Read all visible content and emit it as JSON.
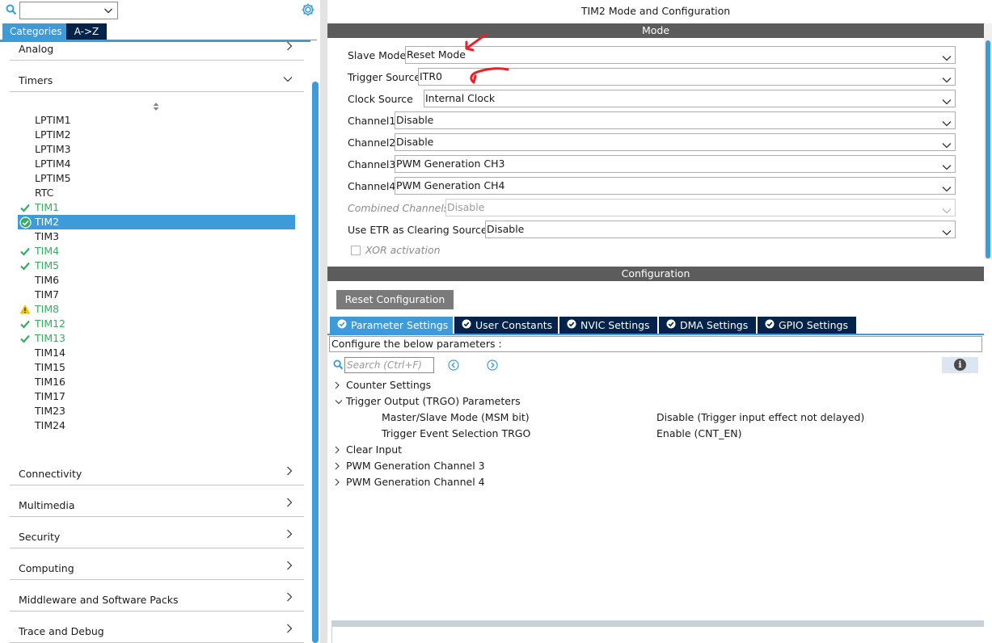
{
  "left_panel": {
    "search_value": "",
    "icons": {
      "search": "search-icon",
      "settings": "gear-icon"
    },
    "view_tabs": {
      "categories": "Categories",
      "a_to_z": "A->Z"
    },
    "categories_top": [
      {
        "label": "Analog",
        "expanded": false
      },
      {
        "label": "Timers",
        "expanded": true
      }
    ],
    "timers": [
      {
        "name": "LPTIM1",
        "status": "none"
      },
      {
        "name": "LPTIM2",
        "status": "none"
      },
      {
        "name": "LPTIM3",
        "status": "none"
      },
      {
        "name": "LPTIM4",
        "status": "none"
      },
      {
        "name": "LPTIM5",
        "status": "none"
      },
      {
        "name": "RTC",
        "status": "none"
      },
      {
        "name": "TIM1",
        "status": "ok"
      },
      {
        "name": "TIM2",
        "status": "ok",
        "selected": true
      },
      {
        "name": "TIM3",
        "status": "none"
      },
      {
        "name": "TIM4",
        "status": "ok"
      },
      {
        "name": "TIM5",
        "status": "ok"
      },
      {
        "name": "TIM6",
        "status": "none"
      },
      {
        "name": "TIM7",
        "status": "none"
      },
      {
        "name": "TIM8",
        "status": "warn"
      },
      {
        "name": "TIM12",
        "status": "ok"
      },
      {
        "name": "TIM13",
        "status": "ok"
      },
      {
        "name": "TIM14",
        "status": "none"
      },
      {
        "name": "TIM15",
        "status": "none"
      },
      {
        "name": "TIM16",
        "status": "none"
      },
      {
        "name": "TIM17",
        "status": "none"
      },
      {
        "name": "TIM23",
        "status": "none"
      },
      {
        "name": "TIM24",
        "status": "none"
      }
    ],
    "categories_bottom": [
      {
        "label": "Connectivity"
      },
      {
        "label": "Multimedia"
      },
      {
        "label": "Security"
      },
      {
        "label": "Computing"
      },
      {
        "label": "Middleware and Software Packs"
      },
      {
        "label": "Trace and Debug"
      }
    ]
  },
  "right_panel": {
    "title": "TIM2 Mode and Configuration",
    "mode_header": "Mode",
    "mode_fields": {
      "slave_mode": {
        "label": "Slave Mode",
        "value": "Reset Mode"
      },
      "trigger_source": {
        "label": "Trigger Source",
        "value": "ITR0"
      },
      "clock_source": {
        "label": "Clock Source",
        "value": "Internal Clock"
      },
      "channel1": {
        "label": "Channel1",
        "value": "Disable"
      },
      "channel2": {
        "label": "Channel2",
        "value": "Disable"
      },
      "channel3": {
        "label": "Channel3",
        "value": "PWM Generation CH3"
      },
      "channel4": {
        "label": "Channel4",
        "value": "PWM Generation CH4"
      },
      "combined_channels": {
        "label": "Combined Channels",
        "value": "Disable",
        "disabled": true
      },
      "use_etr": {
        "label": "Use ETR as Clearing Source",
        "value": "Disable"
      }
    },
    "xor_activation": {
      "label": "XOR activation",
      "checked": false,
      "disabled": true
    },
    "configuration_header": "Configuration",
    "reset_button": "Reset Configuration",
    "config_tabs": [
      {
        "label": "Parameter Settings",
        "active": true
      },
      {
        "label": "User Constants",
        "active": false
      },
      {
        "label": "NVIC Settings",
        "active": false
      },
      {
        "label": "DMA Settings",
        "active": false
      },
      {
        "label": "GPIO Settings",
        "active": false
      }
    ],
    "config_description": "Configure the below parameters :",
    "param_search_placeholder": "Search (Ctrl+F)",
    "param_tree": {
      "counter_settings": "Counter Settings",
      "trgo": "Trigger Output (TRGO) Parameters",
      "msm_label": "Master/Slave Mode (MSM bit)",
      "msm_value": "Disable (Trigger input effect not delayed)",
      "tes_label": "Trigger Event Selection TRGO",
      "tes_value": "Enable (CNT_EN)",
      "clear_input": "Clear Input",
      "pwm3": "PWM Generation Channel 3",
      "pwm4": "PWM Generation Channel 4"
    }
  },
  "colors": {
    "accent_blue": "#3d9bd9",
    "dark_navy": "#03234b",
    "section_gray": "#5c5c5c",
    "ok_green": "#3caa62",
    "warn_yellow": "#f2c200",
    "annotation_red": "#e8202a"
  }
}
